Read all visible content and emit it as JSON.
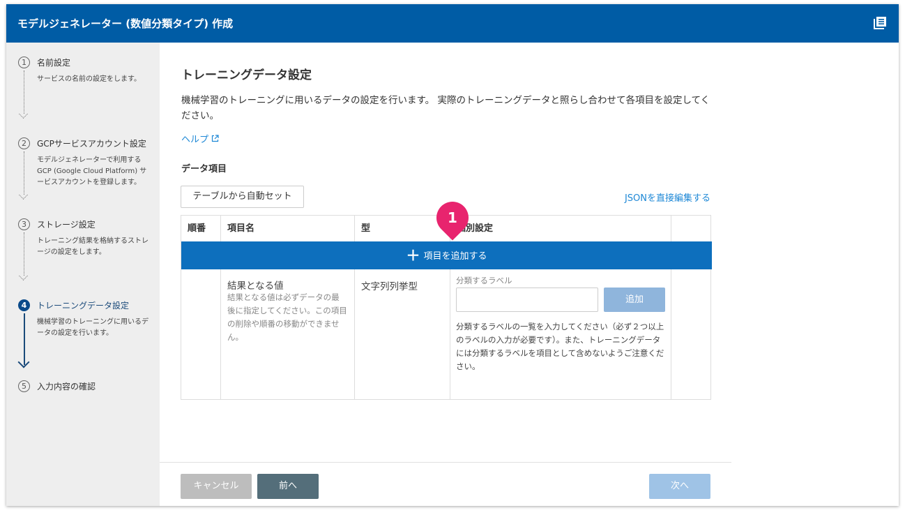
{
  "window": {
    "title": "モデルジェネレーター (数値分類タイプ) 作成"
  },
  "sidebar": {
    "steps": [
      {
        "num": "1",
        "title": "名前設定",
        "desc": "サービスの名前の設定をします。"
      },
      {
        "num": "2",
        "title": "GCPサービスアカウント設定",
        "desc": "モデルジェネレーターで利用するGCP (Google Cloud Platform) サービスアカウントを登録します。"
      },
      {
        "num": "3",
        "title": "ストレージ設定",
        "desc": "トレーニング結果を格納するストレージの設定をします。"
      },
      {
        "num": "4",
        "title": "トレーニングデータ設定",
        "desc": "機械学習のトレーニングに用いるデータの設定を行います。"
      },
      {
        "num": "5",
        "title": "入力内容の確認",
        "desc": ""
      }
    ]
  },
  "main": {
    "heading": "トレーニングデータ設定",
    "description": "機械学習のトレーニングに用いるデータの設定を行います。 実際のトレーニングデータと照らし合わせて各項目を設定してください。",
    "help_link": "ヘルプ",
    "section_title": "データ項目",
    "auto_set_button": "テーブルから自動セット",
    "json_link": "JSONを直接編集する",
    "table": {
      "headers": [
        "順番",
        "項目名",
        "型",
        "個別設定",
        ""
      ],
      "add_row_label": "項目を追加する",
      "row": {
        "name_title": "結果となる値",
        "name_desc": "結果となる値は必ずデータの最後に指定してください。この項目の削除や順番の移動ができません。",
        "type": "文字列列挙型",
        "label_caption": "分類するラベル",
        "label_input_value": "",
        "add_button": "追加",
        "label_help": "分類するラベルの一覧を入力してください（必ず２つ以上のラベルの入力が必要です）。また、トレーニングデータには分類するラベルを項目として含めないようご注意ください。"
      }
    },
    "badge": "1"
  },
  "footer": {
    "cancel": "キャンセル",
    "prev": "前へ",
    "next": "次へ"
  }
}
